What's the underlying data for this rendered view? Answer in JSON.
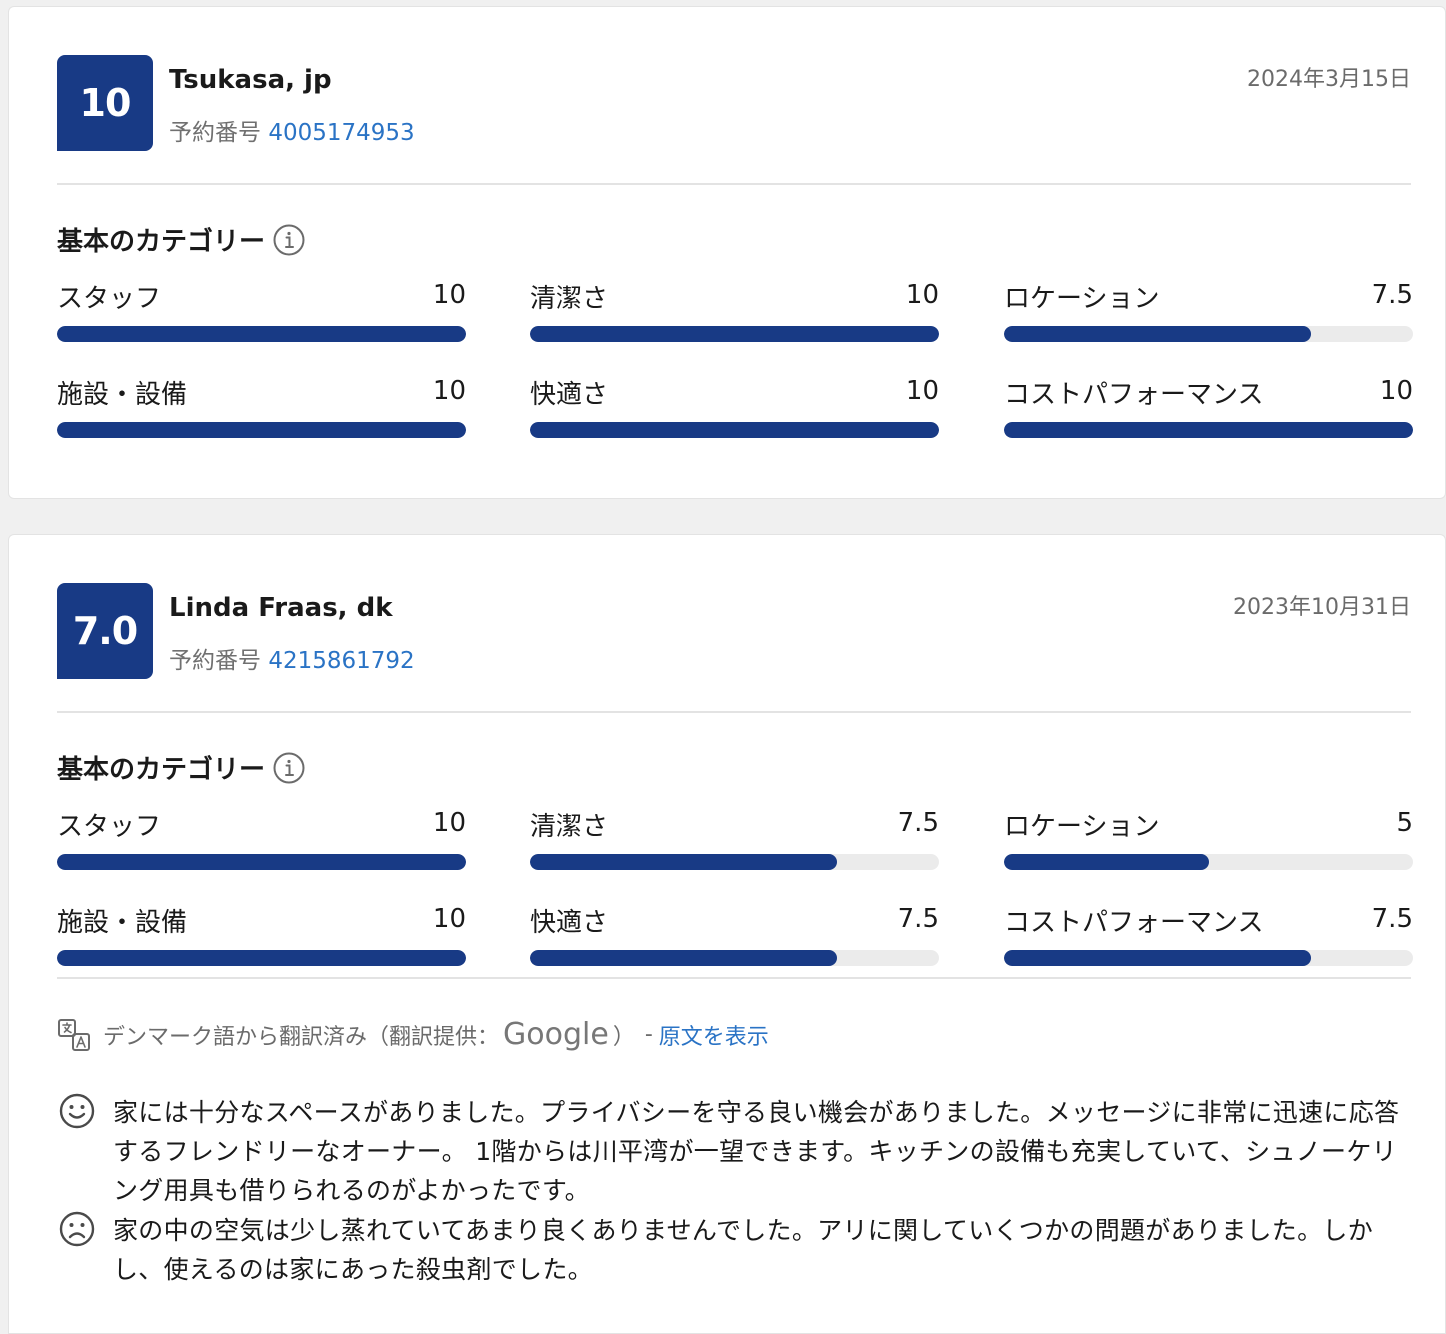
{
  "reviews": [
    {
      "score": "10",
      "reviewer": "Tsukasa, jp",
      "booking_label": "予約番号",
      "booking_number": "4005174953",
      "date": "2024年3月15日",
      "categories_title": "基本のカテゴリー",
      "categories": [
        {
          "label": "スタッフ",
          "value": "10",
          "score": 10
        },
        {
          "label": "清潔さ",
          "value": "10",
          "score": 10
        },
        {
          "label": "ロケーション",
          "value": "7.5",
          "score": 7.5
        },
        {
          "label": "施設・設備",
          "value": "10",
          "score": 10
        },
        {
          "label": "快適さ",
          "value": "10",
          "score": 10
        },
        {
          "label": "コストパフォーマンス",
          "value": "10",
          "score": 10
        }
      ]
    },
    {
      "score": "7.0",
      "reviewer": "Linda Fraas, dk",
      "booking_label": "予約番号",
      "booking_number": "4215861792",
      "date": "2023年10月31日",
      "categories_title": "基本のカテゴリー",
      "categories": [
        {
          "label": "スタッフ",
          "value": "10",
          "score": 10
        },
        {
          "label": "清潔さ",
          "value": "7.5",
          "score": 7.5
        },
        {
          "label": "ロケーション",
          "value": "5",
          "score": 5
        },
        {
          "label": "施設・設備",
          "value": "10",
          "score": 10
        },
        {
          "label": "快適さ",
          "value": "7.5",
          "score": 7.5
        },
        {
          "label": "コストパフォーマンス",
          "value": "7.5",
          "score": 7.5
        }
      ],
      "translation": {
        "text": "デンマーク語から翻訳済み（翻訳提供：",
        "provider": "Google",
        "close_paren": "）",
        "dash": "-",
        "show_original": "原文を表示"
      },
      "positive_comment": "家には十分なスペースがありました。プライバシーを守る良い機会がありました。メッセージに非常に迅速に応答するフレンドリーなオーナー。 1階からは川平湾が一望できます。キッチンの設備も充実していて、シュノーケリング用具も借りられるのがよかったです。",
      "negative_comment": "家の中の空気は少し蒸れていてあまり良くありませんでした。アリに関していくつかの問題がありました。しかし、使えるのは家にあった殺虫剤でした。"
    }
  ],
  "score_max": 10,
  "colors": {
    "brand_blue": "#183a85",
    "link_blue": "#2a73c5",
    "bar_track": "#ebebeb",
    "muted_text": "#6b6b6b"
  },
  "icons": {
    "info": "info-icon",
    "translate": "translate-icon",
    "positive": "smile-icon",
    "negative": "frown-icon"
  }
}
